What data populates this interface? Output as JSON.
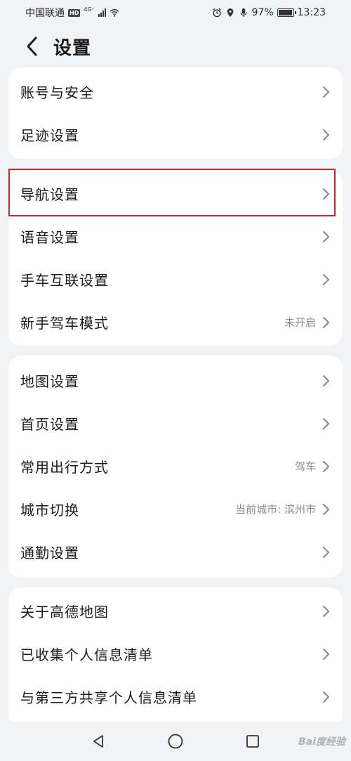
{
  "status_bar": {
    "carrier": "中国联通",
    "hd": "HD",
    "network": "4G⁺",
    "battery_percent": "97%",
    "time": "13:23",
    "icons": [
      "alarm-icon",
      "location-icon",
      "mic-icon",
      "battery-icon",
      "wifi-icon",
      "signal-icon"
    ]
  },
  "header": {
    "title": "设置"
  },
  "groups": [
    {
      "items": [
        {
          "label": "账号与安全",
          "value": ""
        },
        {
          "label": "足迹设置",
          "value": ""
        }
      ]
    },
    {
      "items": [
        {
          "label": "导航设置",
          "value": "",
          "highlighted": true
        },
        {
          "label": "语音设置",
          "value": ""
        },
        {
          "label": "手车互联设置",
          "value": ""
        },
        {
          "label": "新手驾车模式",
          "value": "未开启"
        }
      ]
    },
    {
      "items": [
        {
          "label": "地图设置",
          "value": ""
        },
        {
          "label": "首页设置",
          "value": ""
        },
        {
          "label": "常用出行方式",
          "value": "驾车"
        },
        {
          "label": "城市切换",
          "value": "当前城市: 滨州市"
        },
        {
          "label": "通勤设置",
          "value": ""
        }
      ]
    },
    {
      "items": [
        {
          "label": "关于高德地图",
          "value": ""
        },
        {
          "label": "已收集个人信息清单",
          "value": ""
        },
        {
          "label": "与第三方共享个人信息清单",
          "value": ""
        }
      ]
    }
  ],
  "nav_bar": {
    "icons": [
      "back-triangle-icon",
      "home-circle-icon",
      "recents-square-icon"
    ]
  },
  "watermark": "Bai度经验",
  "colors": {
    "highlight_border": "#c8272f",
    "background": "#f1f3f5",
    "card": "#ffffff",
    "secondary_text": "#8c8c8c"
  }
}
